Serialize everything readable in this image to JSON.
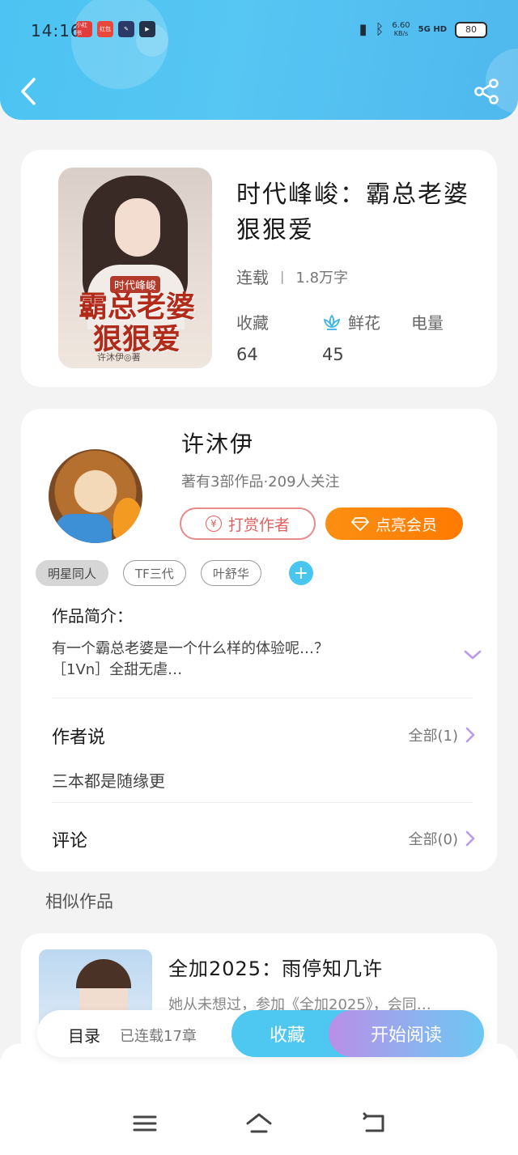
{
  "status_bar": {
    "time": "14:16",
    "app_icons": [
      "小红书",
      "红包",
      "",
      ""
    ],
    "net_speed": "6.60",
    "net_unit": "KB/s",
    "signal": "5G HD",
    "battery": "80"
  },
  "header": {
    "back_icon": "chevron-left-icon",
    "share_icon": "share-icon",
    "accent": "#4cc3f2"
  },
  "book": {
    "title": "时代峰峻：霸总老婆狠狠爱",
    "cover_small": "时代峰峻",
    "cover_title": "霸总老婆狠狠爱",
    "cover_author": "许沐伊◎著",
    "status": "连载",
    "words": "1.8万字",
    "stats": {
      "fav_label": "收藏",
      "fav_value": "64",
      "flower_label": "鲜花",
      "flower_value": "45",
      "power_label": "电量"
    }
  },
  "author": {
    "name": "许沐伊",
    "info": "著有3部作品·209人关注",
    "tip_label": "打赏作者",
    "vip_label": "点亮会员",
    "vip_color": "#ff8a0d"
  },
  "tags": [
    "明星同人",
    "TF三代",
    "叶舒华"
  ],
  "intro": {
    "title": "作品简介：",
    "line1": "有一个霸总老婆是一个什么样的体验呢…？",
    "line2": "［1Vn］全甜无虐…"
  },
  "author_says": {
    "title": "作者说",
    "more": "全部(1)",
    "text": "三本都是随缘更"
  },
  "comments": {
    "title": "评论",
    "more": "全部(0)"
  },
  "similar": {
    "heading": "相似作品",
    "title": "全加2025：雨停知几许",
    "desc": "她从未想过，参加《全加2025》，会同…"
  },
  "bottom_bar": {
    "toc": "目录",
    "chapters": "已连载17章",
    "fav": "收藏",
    "read": "开始阅读"
  }
}
